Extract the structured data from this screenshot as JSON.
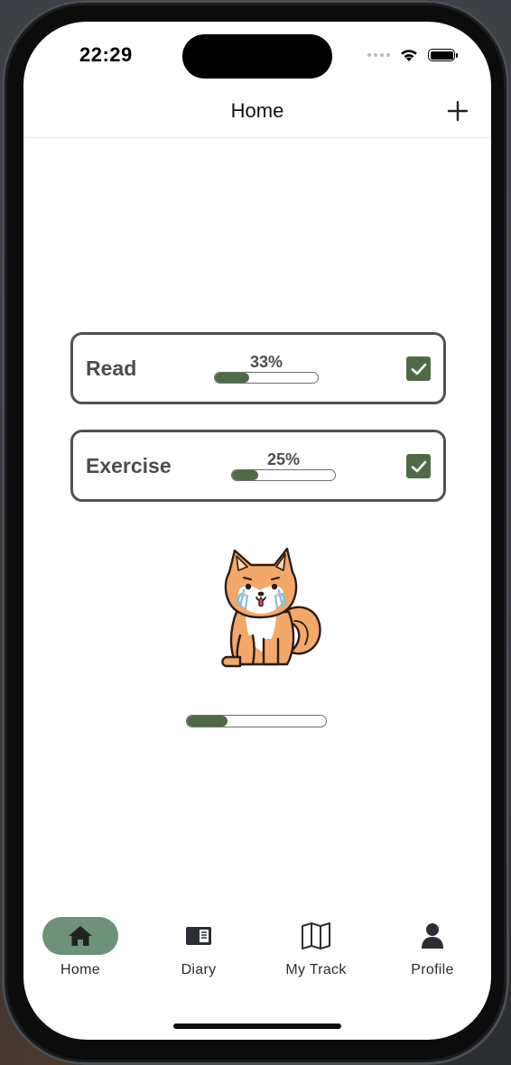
{
  "status_bar": {
    "time": "22:29"
  },
  "header": {
    "title": "Home"
  },
  "habits": [
    {
      "name": "Read",
      "percent_label": "33%",
      "progress": 0.33,
      "checked": true
    },
    {
      "name": "Exercise",
      "percent_label": "25%",
      "progress": 0.25,
      "checked": true
    }
  ],
  "mascot": {
    "icon": "crying-shiba-dog-icon"
  },
  "overall_progress": 0.29,
  "tabs": [
    {
      "label": "Home",
      "icon": "house-icon",
      "active": true
    },
    {
      "label": "Diary",
      "icon": "diary-book-icon",
      "active": false
    },
    {
      "label": "My Track",
      "icon": "map-icon",
      "active": false
    },
    {
      "label": "Profile",
      "icon": "person-icon",
      "active": false
    }
  ],
  "colors": {
    "accent": "#4f6b45",
    "tab_active_bg": "#6e9278",
    "card_border": "#4d5450",
    "text": "#4a4f4c"
  }
}
